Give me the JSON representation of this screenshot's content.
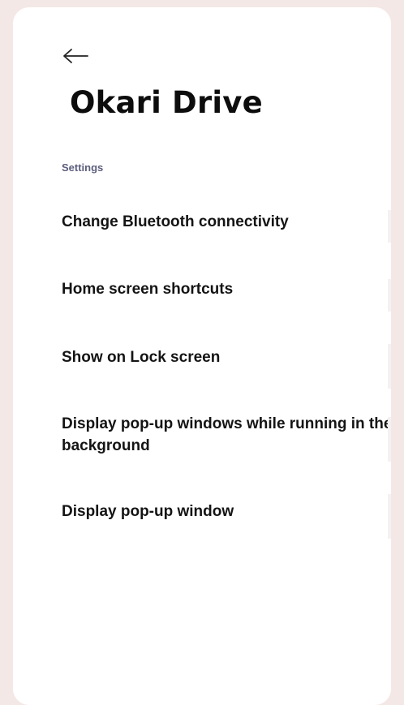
{
  "header": {
    "back_icon": "arrow-left-icon",
    "title": "Okari Drive"
  },
  "settings": {
    "section_label": "Settings",
    "items": [
      {
        "label": "Change Bluetooth connectivity"
      },
      {
        "label": "Home screen shortcuts"
      },
      {
        "label": "Show on Lock screen"
      },
      {
        "label": "Display pop-up windows while running in the background"
      },
      {
        "label": "Display pop-up window"
      }
    ]
  },
  "colors": {
    "page_background": "#f4e8e6",
    "card_background": "#ffffff",
    "section_label": "#5c5e7c",
    "text": "#141414"
  }
}
